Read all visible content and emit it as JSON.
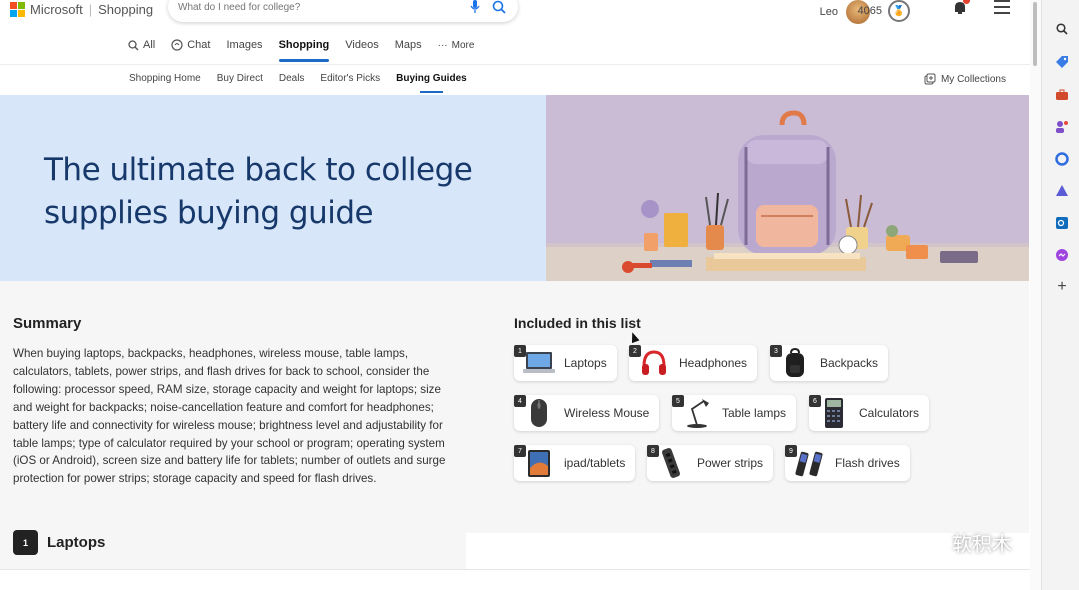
{
  "header": {
    "brand": "Microsoft",
    "product": "Shopping",
    "search_placeholder": "What do I need for college?",
    "user_name": "Leo",
    "points": "4065"
  },
  "scopes": [
    {
      "label": "All",
      "icon": "search-icon"
    },
    {
      "label": "Chat",
      "icon": "chat-icon"
    },
    {
      "label": "Images"
    },
    {
      "label": "Shopping",
      "active": true
    },
    {
      "label": "Videos"
    },
    {
      "label": "Maps"
    },
    {
      "label": "More",
      "icon": "more-dots-icon"
    }
  ],
  "subnav": {
    "items": [
      "Shopping Home",
      "Buy Direct",
      "Deals",
      "Editor's Picks",
      "Buying Guides"
    ],
    "active": "Buying Guides",
    "collections_label": "My Collections"
  },
  "hero": {
    "title": "The ultimate back to college supplies buying guide"
  },
  "summary": {
    "heading": "Summary",
    "body": "When buying laptops, backpacks, headphones, wireless mouse, table lamps, calculators, tablets, power strips, and flash drives for back to school, consider the following: processor speed, RAM size, storage capacity and weight for laptops; size and weight for backpacks; noise-cancellation feature and comfort for headphones; battery life and connectivity for wireless mouse; brightness level and adjustability for table lamps; type of calculator required by your school or program; operating system (iOS or Android), screen size and battery life for tablets; number of outlets and surge protection for power strips; storage capacity and speed for flash drives."
  },
  "included": {
    "heading": "Included in this list",
    "items": [
      {
        "num": "1",
        "label": "Laptops",
        "icon": "laptop-icon"
      },
      {
        "num": "2",
        "label": "Headphones",
        "icon": "headphones-icon"
      },
      {
        "num": "3",
        "label": "Backpacks",
        "icon": "backpack-icon"
      },
      {
        "num": "4",
        "label": "Wireless Mouse",
        "icon": "mouse-icon"
      },
      {
        "num": "5",
        "label": "Table lamps",
        "icon": "lamp-icon"
      },
      {
        "num": "6",
        "label": "Calculators",
        "icon": "calculator-icon"
      },
      {
        "num": "7",
        "label": "ipad/tablets",
        "icon": "tablet-icon"
      },
      {
        "num": "8",
        "label": "Power strips",
        "icon": "power-strip-icon"
      },
      {
        "num": "9",
        "label": "Flash drives",
        "icon": "flash-drive-icon"
      }
    ]
  },
  "section1": {
    "num": "1",
    "label": "Laptops"
  },
  "watermark": "软积木",
  "colors": {
    "accent": "#1b6ac9",
    "hero_bg": "#d7e6f9",
    "hero_title": "#17386a"
  }
}
